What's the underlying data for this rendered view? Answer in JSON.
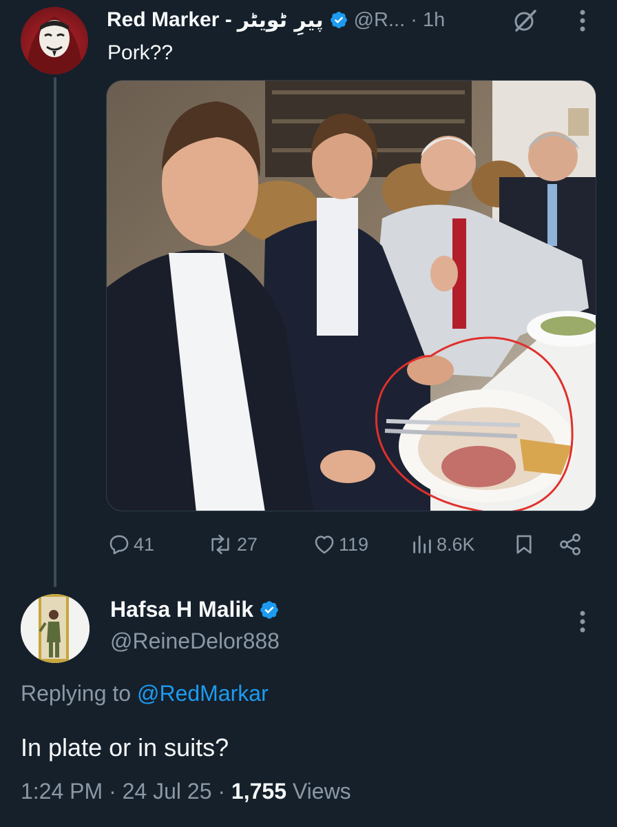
{
  "tweet": {
    "display_name": "Red Marker -",
    "urdu_name": "پیرِ ٹویٹر",
    "handle_truncated": "@R...",
    "time_ago": "1h",
    "text": "Pork??",
    "stats": {
      "replies": "41",
      "reposts": "27",
      "likes": "119",
      "views": "8.6K"
    }
  },
  "reply": {
    "display_name": "Hafsa H Malik",
    "handle": "@ReineDelor888",
    "replying_prefix": "Replying to",
    "replying_to": "@RedMarkar",
    "text": "In plate or in suits?",
    "time": "1:24 PM",
    "date": "24 Jul 25",
    "views_count": "1,755",
    "views_label": "Views"
  },
  "icons": {
    "verified": "verified-badge-icon",
    "grok": "grok-icon",
    "more": "more-vertical-icon",
    "reply": "reply-icon",
    "repost": "repost-icon",
    "like": "like-icon",
    "views": "views-icon",
    "bookmark": "bookmark-icon",
    "share": "share-icon"
  },
  "colors": {
    "background": "#15202b",
    "text_primary": "#f7f9f9",
    "text_secondary": "#8b98a5",
    "accent": "#1d9bf0",
    "thread_line": "#3d4a57"
  }
}
